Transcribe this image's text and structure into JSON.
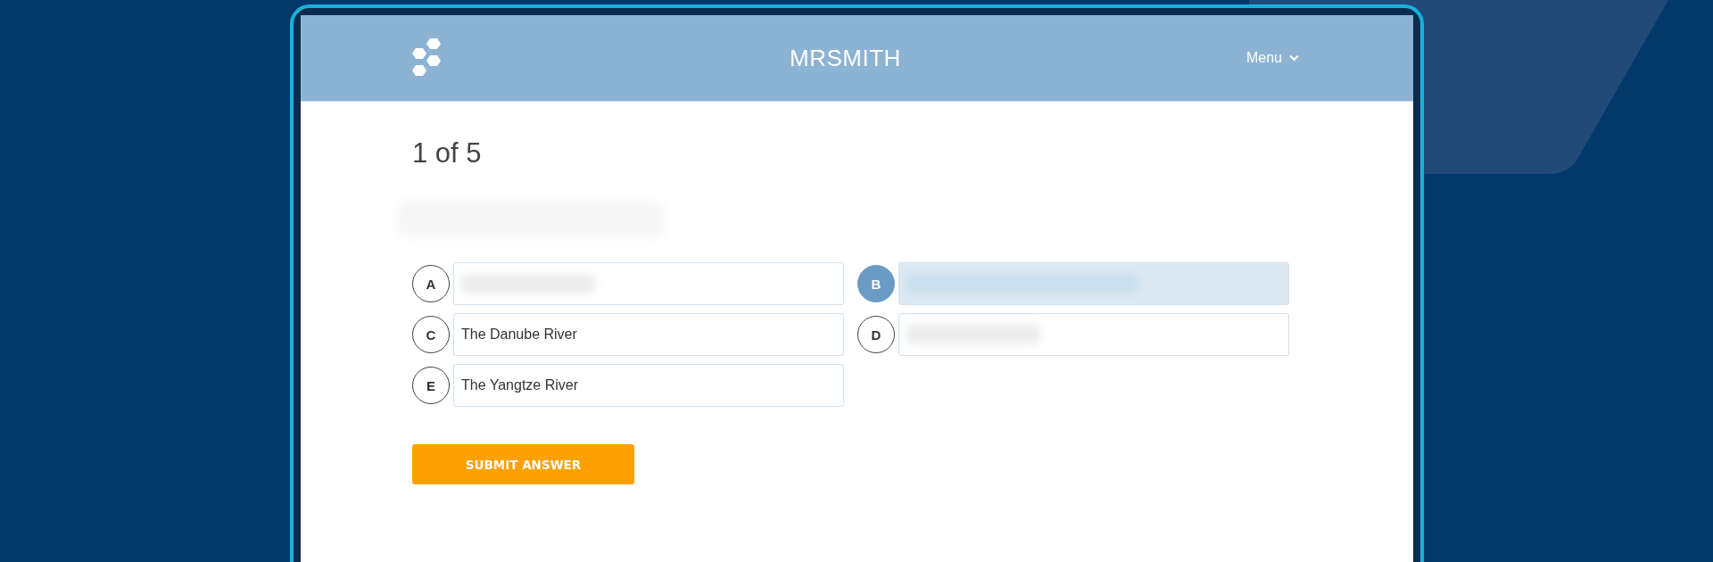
{
  "header": {
    "title": "MRSMITH",
    "menu": "Menu"
  },
  "progress": "1 of 5",
  "question": {
    "kind": "blurred"
  },
  "options": [
    {
      "letter": "A",
      "kind": "blurred",
      "selected": false
    },
    {
      "letter": "B",
      "kind": "blurred",
      "selected": true
    },
    {
      "letter": "C",
      "kind": "text",
      "text": "The Danube River",
      "selected": false
    },
    {
      "letter": "D",
      "kind": "blurred",
      "selected": false
    },
    {
      "letter": "E",
      "kind": "text",
      "text": "The Yangtze River",
      "selected": false
    }
  ],
  "submit": "SUBMIT ANSWER"
}
